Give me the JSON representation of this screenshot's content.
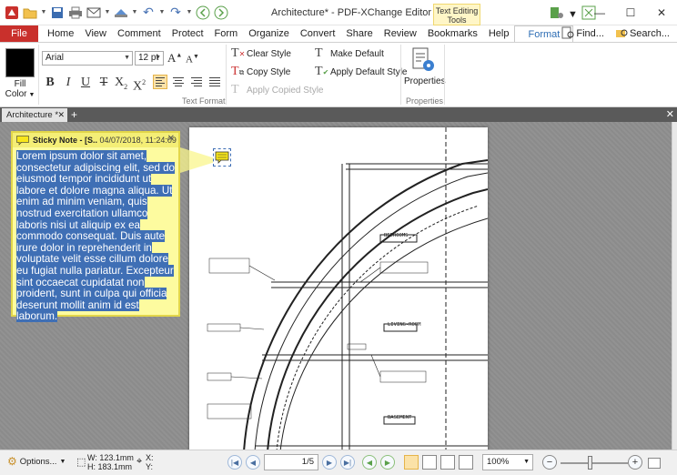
{
  "window": {
    "title": "Architecture* - PDF-XChange Editor",
    "context_tab": "Text Editing Tools"
  },
  "menu": {
    "file": "File",
    "tabs": [
      "Home",
      "View",
      "Comment",
      "Protect",
      "Form",
      "Organize",
      "Convert",
      "Share",
      "Review",
      "Bookmarks",
      "Help",
      "Format"
    ],
    "active_tab": "Format",
    "find": "Find...",
    "search": "Search..."
  },
  "ribbon": {
    "fill_label_line1": "Fill",
    "fill_label_line2": "Color",
    "fill_color": "#000000",
    "font_value": "Arial",
    "size_value": "12 pt",
    "styles": {
      "clear_style": "Clear Style",
      "copy_style": "Copy Style",
      "apply_copied_style": "Apply Copied Style",
      "make_default": "Make Default",
      "apply_default_style": "Apply Default Style"
    },
    "text_format_label": "Text Format",
    "properties_label": "Properties",
    "properties_group_label": "Properties"
  },
  "doc_tabs": {
    "active": "Architecture *"
  },
  "sticky_note": {
    "author": "Sticky Note - [S..",
    "date": "04/07/2018, 11:24:09",
    "text": "Lorem ipsum dolor sit amet, consectetur adipiscing elit, sed do eiusmod tempor incididunt ut labore et dolore magna aliqua. Ut enim ad minim veniam, quis nostrud exercitation ullamco laboris nisi ut aliquip ex ea commodo consequat. Duis aute irure dolor in reprehenderit in voluptate velit esse cillum dolore eu fugiat nulla pariatur. Excepteur sint occaecat cupidatat non proident, sunt in culpa qui officia deserunt mollit anim id est laborum."
  },
  "drawing": {
    "labels": {
      "bedroom": "BEDROOMS",
      "living": "LIVING-ROOM",
      "basement": "BASEMENT"
    }
  },
  "statusbar": {
    "options": "Options...",
    "width": "W: 123.1mm",
    "height": "H: 183.1mm",
    "x": "X:",
    "y": "Y:",
    "page": "1/5",
    "zoom": "100%"
  },
  "colors": {
    "accent": "#2d6db4",
    "file_tab": "#c9302c",
    "note_bg": "#fdfb9f",
    "selection": "#3f6fb5"
  }
}
